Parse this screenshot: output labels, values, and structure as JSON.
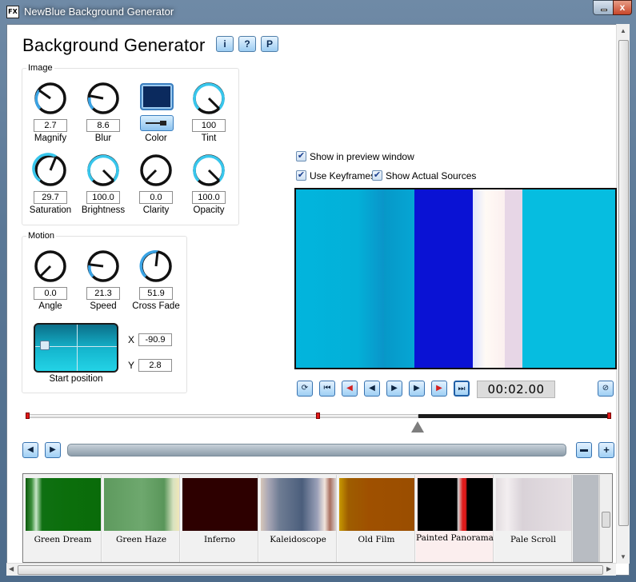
{
  "window": {
    "app_badge": "FX",
    "title": "NewBlue Background Generator",
    "close_label": "x"
  },
  "header": {
    "title": "Background Generator",
    "info_label": "i",
    "help_label": "?",
    "preset_label": "P"
  },
  "image_group": {
    "label": "Image",
    "knobs": [
      {
        "label": "Magnify",
        "value": "2.7"
      },
      {
        "label": "Blur",
        "value": "8.6"
      },
      {
        "label": "Tint",
        "value": "100"
      },
      {
        "label": "Saturation",
        "value": "29.7"
      },
      {
        "label": "Brightness",
        "value": "100.0"
      },
      {
        "label": "Clarity",
        "value": "0.0"
      },
      {
        "label": "Opacity",
        "value": "100.0"
      }
    ],
    "color": {
      "label": "Color",
      "value": "#0b2a5e"
    }
  },
  "motion_group": {
    "label": "Motion",
    "knobs": [
      {
        "label": "Angle",
        "value": "0.0"
      },
      {
        "label": "Speed",
        "value": "21.3"
      },
      {
        "label": "Cross Fade",
        "value": "51.9"
      }
    ],
    "start_position": {
      "label": "Start position",
      "x_label": "X",
      "x_value": "-90.9",
      "y_label": "Y",
      "y_value": "2.8"
    }
  },
  "preview_options": {
    "show_preview": {
      "label": "Show in preview window",
      "checked": true
    },
    "use_keyframes": {
      "label": "Use Keyframes",
      "checked": true
    },
    "show_sources": {
      "label": "Show Actual Sources",
      "checked": true
    }
  },
  "transport": {
    "timecode": "00:02.00"
  },
  "presets": [
    {
      "name": "Green Dream"
    },
    {
      "name": "Green Haze"
    },
    {
      "name": "Inferno"
    },
    {
      "name": "Kaleidoscope"
    },
    {
      "name": "Old Film"
    },
    {
      "name": "Painted Panorama"
    },
    {
      "name": "Pale Scroll"
    }
  ],
  "colors": {
    "accent": "#3b9bd8",
    "preview_bg": "#01b1dc",
    "keyframe": "#e01818"
  }
}
